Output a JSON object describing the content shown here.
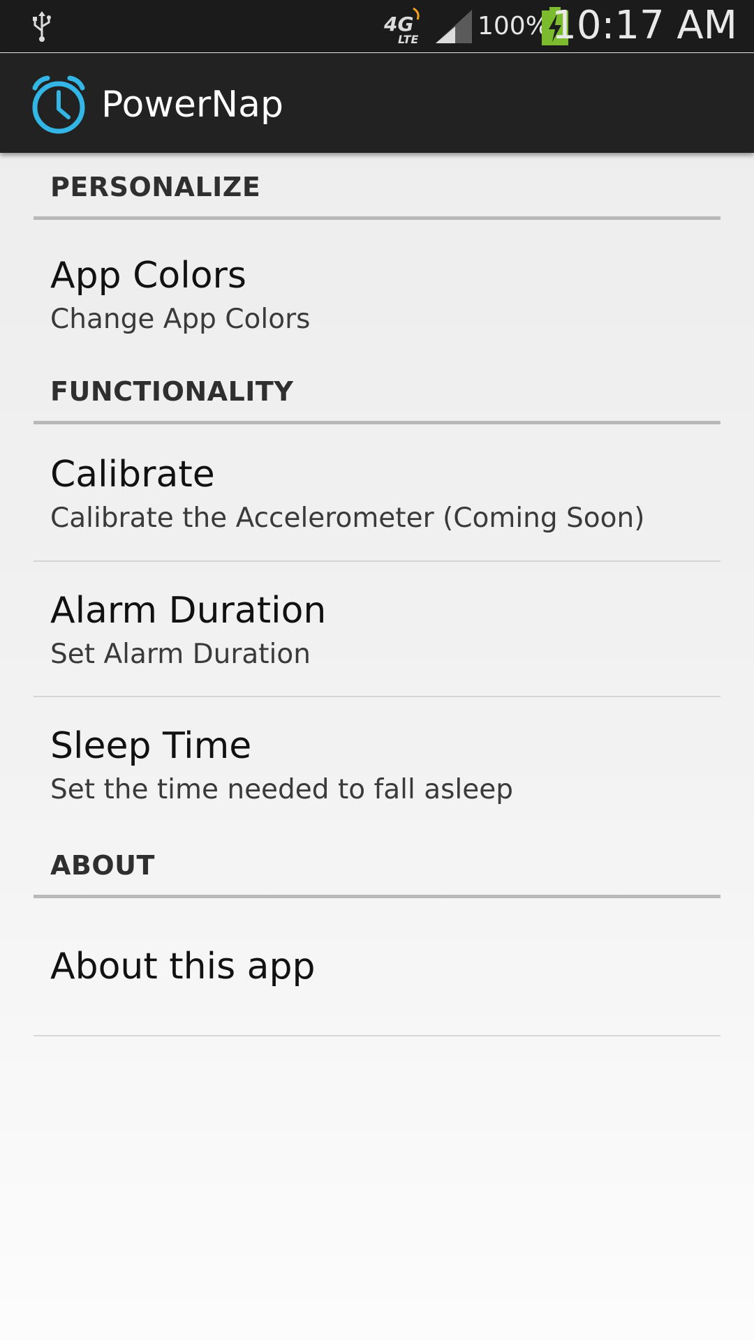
{
  "status_bar": {
    "network_type": "4G LTE",
    "battery_percent": "100%",
    "time": "10:17 AM",
    "icons": [
      "usb-icon",
      "network-4g-lte-icon",
      "signal-strength-icon",
      "battery-charging-icon"
    ]
  },
  "action_bar": {
    "app_name": "PowerNap",
    "logo_icon": "alarm-clock-icon",
    "accent_color": "#33b5e5"
  },
  "sections": {
    "personalize": {
      "header": "PERSONALIZE",
      "items": [
        {
          "title": "App Colors",
          "summary": "Change App Colors"
        }
      ]
    },
    "functionality": {
      "header": "FUNCTIONALITY",
      "items": [
        {
          "title": "Calibrate",
          "summary": "Calibrate the Accelerometer (Coming Soon)"
        },
        {
          "title": "Alarm Duration",
          "summary": "Set Alarm Duration"
        },
        {
          "title": "Sleep Time",
          "summary": "Set the time needed to fall asleep"
        }
      ]
    },
    "about": {
      "header": "ABOUT",
      "items": [
        {
          "title": "About this app"
        }
      ]
    }
  }
}
